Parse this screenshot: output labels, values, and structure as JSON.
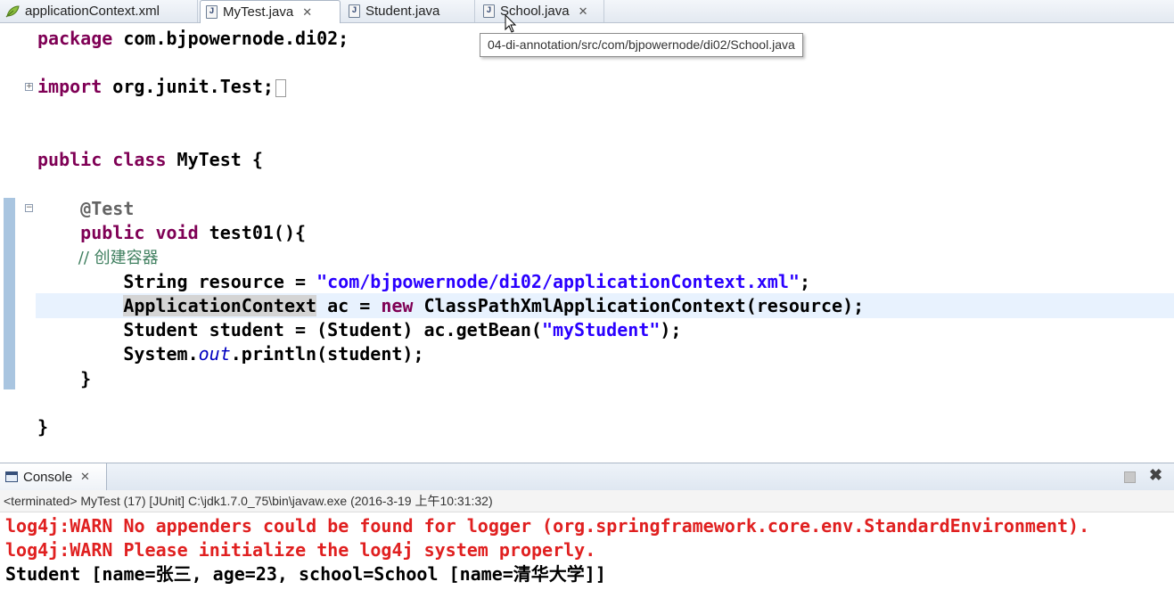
{
  "tabs": [
    {
      "label": "applicationContext.xml",
      "icon": "xml-file-icon",
      "active": false,
      "closable": false
    },
    {
      "label": "MyTest.java",
      "icon": "java-file-icon",
      "active": true,
      "closable": true,
      "close_glyph": "✕"
    },
    {
      "label": "Student.java",
      "icon": "java-file-icon",
      "active": false,
      "closable": false
    },
    {
      "label": "School.java",
      "icon": "java-file-icon",
      "active": false,
      "closable": true,
      "close_glyph": "✕"
    }
  ],
  "java_icon_glyph": "J",
  "tooltip": "04-di-annotation/src/com/bjpowernode/di02/School.java",
  "code": {
    "l1_kw": "package",
    "l1_rest": " com.bjpowernode.di02;",
    "l2_kw": "import",
    "l2_rest": " org.junit.Test;",
    "l3_kw1": "public",
    "l3_kw2": "class",
    "l3_rest": " MyTest {",
    "l4_ann": "    @Test",
    "l5_kw1": "    public",
    "l5_kw2": "void",
    "l5_rest": " test01(){",
    "l6_comment": "        // 创建容器",
    "l7_pre": "        String resource = ",
    "l7_str": "\"com/bjpowernode/di02/applicationContext.xml\"",
    "l7_post": ";",
    "l8_pre": "        ",
    "l8_occ": "ApplicationContext",
    "l8_mid": " ac = ",
    "l8_kw": "new",
    "l8_post": " ClassPathXmlApplicationContext(resource);",
    "l9_pre": "        Student student = (Student) ac.getBean(",
    "l9_str": "\"myStudent\"",
    "l9_post": ");",
    "l10_pre": "        System.",
    "l10_ital": "out",
    "l10_post": ".println(student);",
    "l11": "    }",
    "l12": "}"
  },
  "console": {
    "tab_label": "Console",
    "close_glyph": "✕",
    "remove_glyph": "✖",
    "status": "<terminated> MyTest (17) [JUnit] C:\\jdk1.7.0_75\\bin\\javaw.exe (2016-3-19 上午10:31:32)",
    "lines": [
      "log4j:WARN No appenders could be found for logger (org.springframework.core.env.StandardEnvironment).",
      "log4j:WARN Please initialize the log4j system properly.",
      "Student [name=张三, age=23, school=School [name=清华大学]]"
    ]
  },
  "colors": {
    "keyword": "#7f0055",
    "string": "#2a00ff",
    "comment": "#3f7f5f",
    "annotation": "#646464",
    "static_field": "#0000c0",
    "console_error": "#e02020"
  }
}
